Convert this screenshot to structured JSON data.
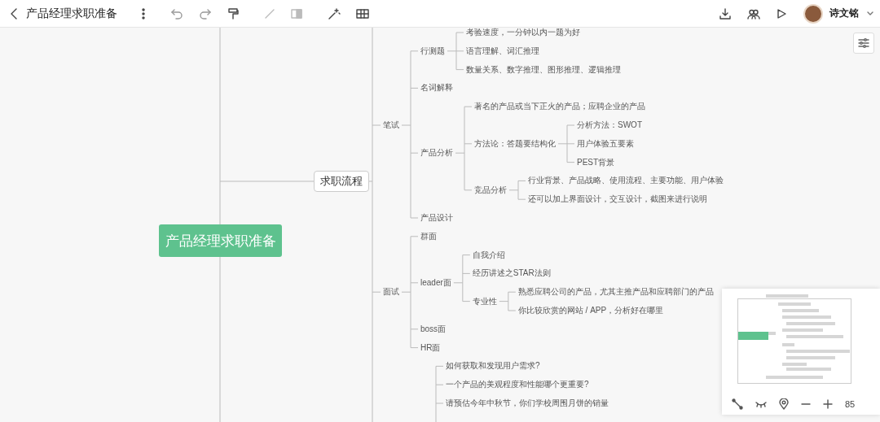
{
  "toolbar": {
    "title": "产品经理求职准备",
    "user": "诗文铭"
  },
  "mindmap": {
    "root": "产品经理求职准备",
    "branch": {
      "label": "求职流程",
      "children": [
        {
          "label": "笔试",
          "children": [
            {
              "label": "行测题",
              "children": [
                {
                  "label": "考验速度，一分钟以内一题为好"
                },
                {
                  "label": "语言理解、词汇推理"
                },
                {
                  "label": "数量关系、数字推理、图形推理、逻辑推理"
                }
              ]
            },
            {
              "label": "名词解释"
            },
            {
              "label": "产品分析",
              "children": [
                {
                  "label": "著名的产品或当下正火的产品；应聘企业的产品"
                },
                {
                  "label": "方法论：答题要结构化",
                  "children": [
                    {
                      "label": "分析方法：SWOT"
                    },
                    {
                      "label": "用户体验五要素"
                    },
                    {
                      "label": "PEST背景"
                    }
                  ]
                },
                {
                  "label": "竞品分析",
                  "children": [
                    {
                      "label": "行业背景、产品战略、使用流程、主要功能、用户体验"
                    },
                    {
                      "label": "还可以加上界面设计，交互设计，截图来进行说明"
                    }
                  ]
                }
              ]
            },
            {
              "label": "产品设计"
            }
          ]
        },
        {
          "label": "面试",
          "children": [
            {
              "label": "群面"
            },
            {
              "label": "leader面",
              "children": [
                {
                  "label": "自我介绍"
                },
                {
                  "label": "经历讲述之STAR法则"
                },
                {
                  "label": "专业性",
                  "children": [
                    {
                      "label": "熟悉应聘公司的产品，尤其主推产品和应聘部门的产品"
                    },
                    {
                      "label": "你比较欣赏的网站 / APP，分析好在哪里"
                    }
                  ]
                }
              ]
            },
            {
              "label": "boss面"
            },
            {
              "label": "HR面"
            }
          ]
        },
        {
          "children": [
            {
              "label": "如何获取和发现用户需求?"
            },
            {
              "label": "一个产品的美观程度和性能哪个更重要?"
            },
            {
              "label": "请预估今年中秋节，你们学校周围月饼的销量"
            }
          ]
        }
      ]
    }
  },
  "zoom": {
    "value": "85"
  }
}
